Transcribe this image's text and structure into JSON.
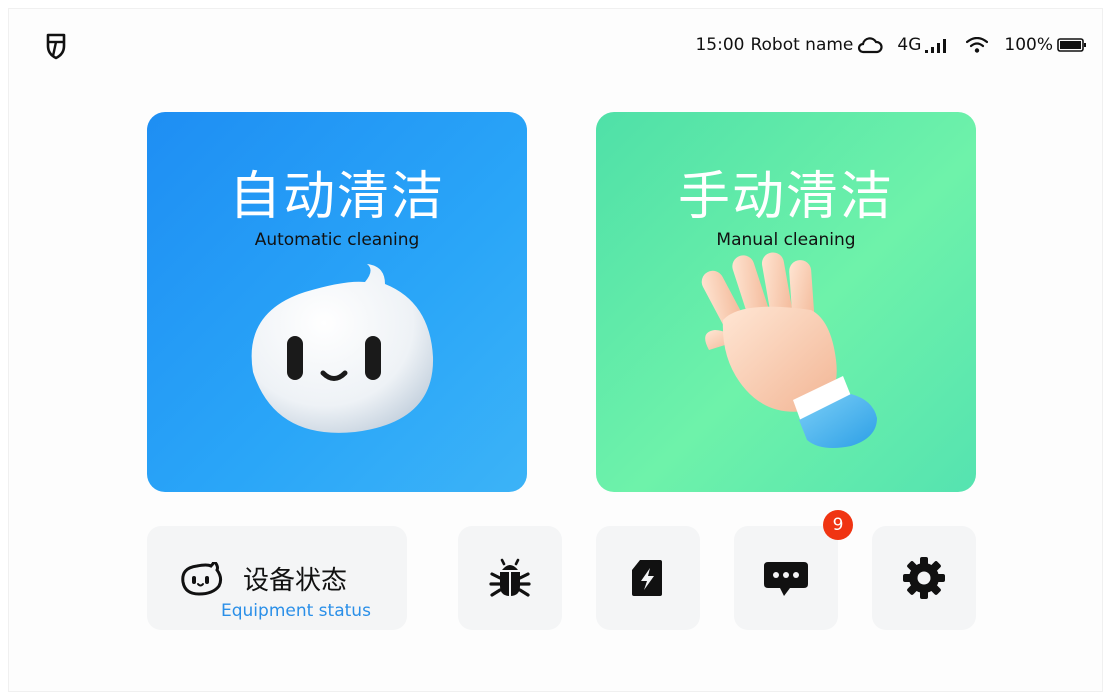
{
  "status_bar": {
    "time": "15:00",
    "robot_name": "Robot name",
    "network": "4G",
    "battery": "100%"
  },
  "cards": {
    "auto": {
      "title_cn": "自动清洁",
      "title_en": "Automatic cleaning"
    },
    "manual": {
      "title_cn": "手动清洁",
      "title_en": "Manual cleaning"
    }
  },
  "equipment_status": {
    "label_cn": "设备状态",
    "label_en": "Equipment status"
  },
  "actions": [
    {
      "icon": "bug-icon"
    },
    {
      "icon": "charge-icon"
    },
    {
      "icon": "message-icon",
      "badge": "9"
    },
    {
      "icon": "gear-icon"
    }
  ],
  "colors": {
    "auto_card": "#1e8ef3",
    "manual_card": "#5ae8a8",
    "accent_blue": "#2a8fe8",
    "badge_red": "#f03412"
  }
}
